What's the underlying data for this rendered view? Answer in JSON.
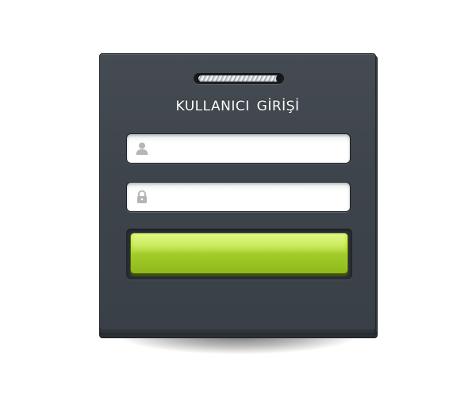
{
  "login": {
    "title": "KULLANICI GİRİŞİ",
    "username": {
      "value": "",
      "placeholder": "",
      "icon": "user-icon"
    },
    "password": {
      "value": "",
      "placeholder": "",
      "icon": "lock-icon"
    },
    "submit_label": ""
  },
  "colors": {
    "panel": "#3e444b",
    "button": "#a3cc2a",
    "title_text": "#ffffff"
  }
}
